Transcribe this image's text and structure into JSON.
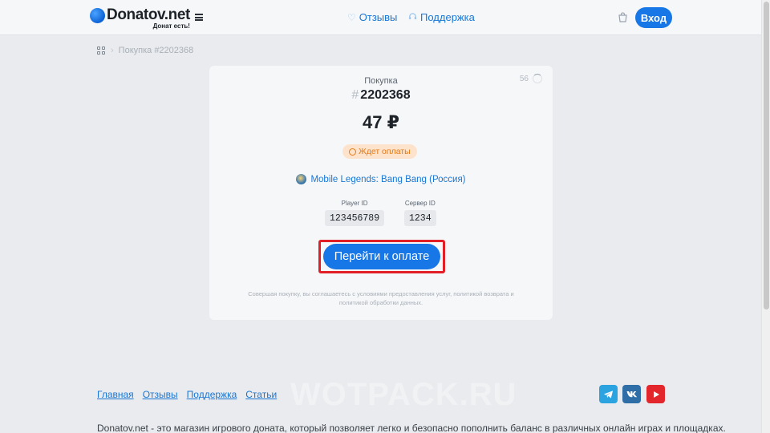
{
  "header": {
    "logo_name": "Donatov.net",
    "logo_tagline": "Донат есть!",
    "nav": [
      {
        "label": "Отзывы",
        "icon": "heart-icon"
      },
      {
        "label": "Поддержка",
        "icon": "headset-icon"
      }
    ],
    "login_label": "Вход"
  },
  "breadcrumb": {
    "current": "Покупка #2202368"
  },
  "card": {
    "timer": "56",
    "purchase_label": "Покупка",
    "order_hash": "#",
    "order_number": "2202368",
    "amount": "47 ₽",
    "status": "Ждет оплаты",
    "game": "Mobile Legends: Bang Bang (Россия)",
    "fields": [
      {
        "label": "Player ID",
        "value": "123456789"
      },
      {
        "label": "Сервер ID",
        "value": "1234"
      }
    ],
    "pay_button": "Перейти к оплате",
    "disclaimer": "Совершая покупку, вы соглашаетесь с условиями предоставления услуг, политикой возврата и политикой обработки данных."
  },
  "footer": {
    "links": [
      "Главная",
      "Отзывы",
      "Поддержка",
      "Статьи"
    ],
    "watermark": "WOTPACK.RU",
    "social": [
      {
        "name": "telegram-icon",
        "color": "#2ba3e0"
      },
      {
        "name": "vk-icon",
        "color": "#2f6ea7"
      },
      {
        "name": "youtube-icon",
        "color": "#e3262c"
      }
    ],
    "description": "Donatov.net - это магазин игрового доната, который позволяет легко и безопасно пополнить баланс в различных онлайн играх и площадках."
  },
  "colors": {
    "accent": "#1877e6",
    "status_bg": "#fde3cc",
    "status_fg": "#e57a16",
    "highlight_border": "#e21e26"
  }
}
